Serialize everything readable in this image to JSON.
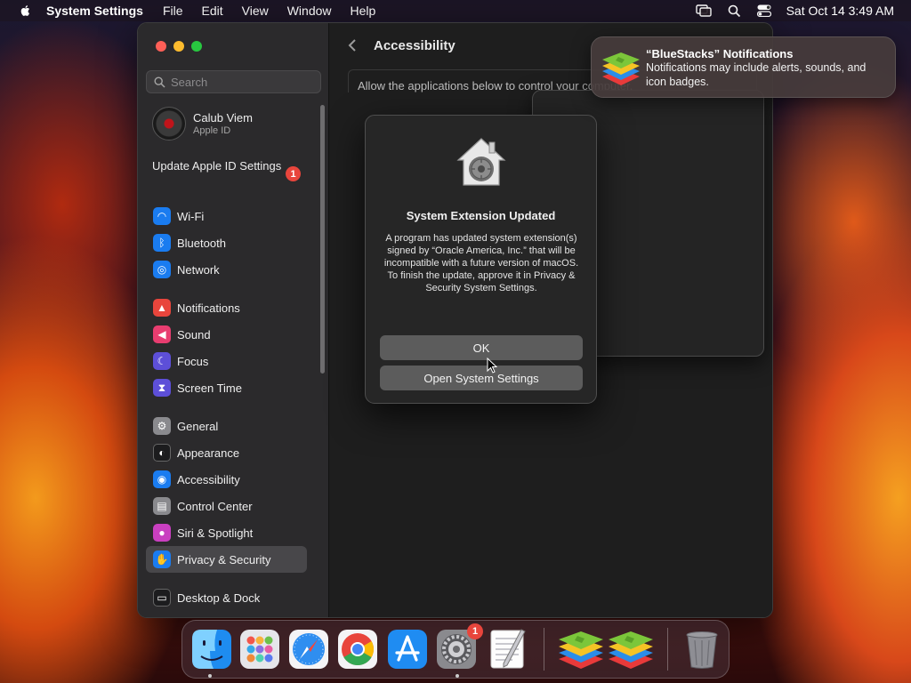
{
  "menubar": {
    "app_name": "System Settings",
    "items": [
      "File",
      "Edit",
      "View",
      "Window",
      "Help"
    ],
    "clock": "Sat Oct 14  3:49 AM",
    "status_icons": [
      "screen-mirroring-icon",
      "spotlight-search-icon",
      "control-center-icon"
    ]
  },
  "sidebar": {
    "search_placeholder": "Search",
    "user": {
      "name": "Calub Viem",
      "subtitle": "Apple ID"
    },
    "update": {
      "label": "Update Apple ID Settings",
      "badge": "1"
    },
    "items": [
      {
        "label": "Wi-Fi",
        "icon": "wifi-icon",
        "color": "#1a7cf0"
      },
      {
        "label": "Bluetooth",
        "icon": "bluetooth-icon",
        "color": "#1a7cf0"
      },
      {
        "label": "Network",
        "icon": "globe-icon",
        "color": "#1a7cf0"
      },
      {
        "label": "Notifications",
        "icon": "bell-icon",
        "color": "#e8453c"
      },
      {
        "label": "Sound",
        "icon": "speaker-icon",
        "color": "#e83d70"
      },
      {
        "label": "Focus",
        "icon": "moon-icon",
        "color": "#5d4fd8"
      },
      {
        "label": "Screen Time",
        "icon": "hourglass-icon",
        "color": "#5d4fd8"
      },
      {
        "label": "General",
        "icon": "gear-icon",
        "color": "#8a8a8e"
      },
      {
        "label": "Appearance",
        "icon": "appearance-icon",
        "color": "#1c1c1e"
      },
      {
        "label": "Accessibility",
        "icon": "accessibility-icon",
        "color": "#1a7cf0"
      },
      {
        "label": "Control Center",
        "icon": "control-center-icon",
        "color": "#8a8a8e"
      },
      {
        "label": "Siri & Spotlight",
        "icon": "siri-icon",
        "color": "#c93fc0"
      },
      {
        "label": "Privacy & Security",
        "icon": "hand-icon",
        "color": "#1a7cf0",
        "selected": true
      },
      {
        "label": "Desktop & Dock",
        "icon": "dock-icon",
        "color": "#1c1c1e"
      }
    ]
  },
  "content": {
    "title": "Accessibility",
    "description": "Allow the applications below to control your computer."
  },
  "dialog": {
    "title": "System Extension Updated",
    "message": "A program has updated system extension(s) signed by “Oracle America, Inc.” that will be incompatible with a future version of macOS. To finish the update, approve it in Privacy & Security System Settings.",
    "ok_label": "OK",
    "open_label": "Open System Settings",
    "icon": "security-lock-icon"
  },
  "notification": {
    "title": "“BlueStacks” Notifications",
    "body": "Notifications may include alerts, sounds, and icon badges.",
    "icon": "bluestacks-icon"
  },
  "dock": {
    "apps": [
      "finder-icon",
      "launchpad-icon",
      "safari-icon",
      "chrome-icon",
      "app-store-icon",
      "system-settings-icon",
      "textedit-icon",
      "bluestacks-icon",
      "bluestacks-multi-instance-icon",
      "trash-icon"
    ],
    "settings_badge": "1"
  }
}
